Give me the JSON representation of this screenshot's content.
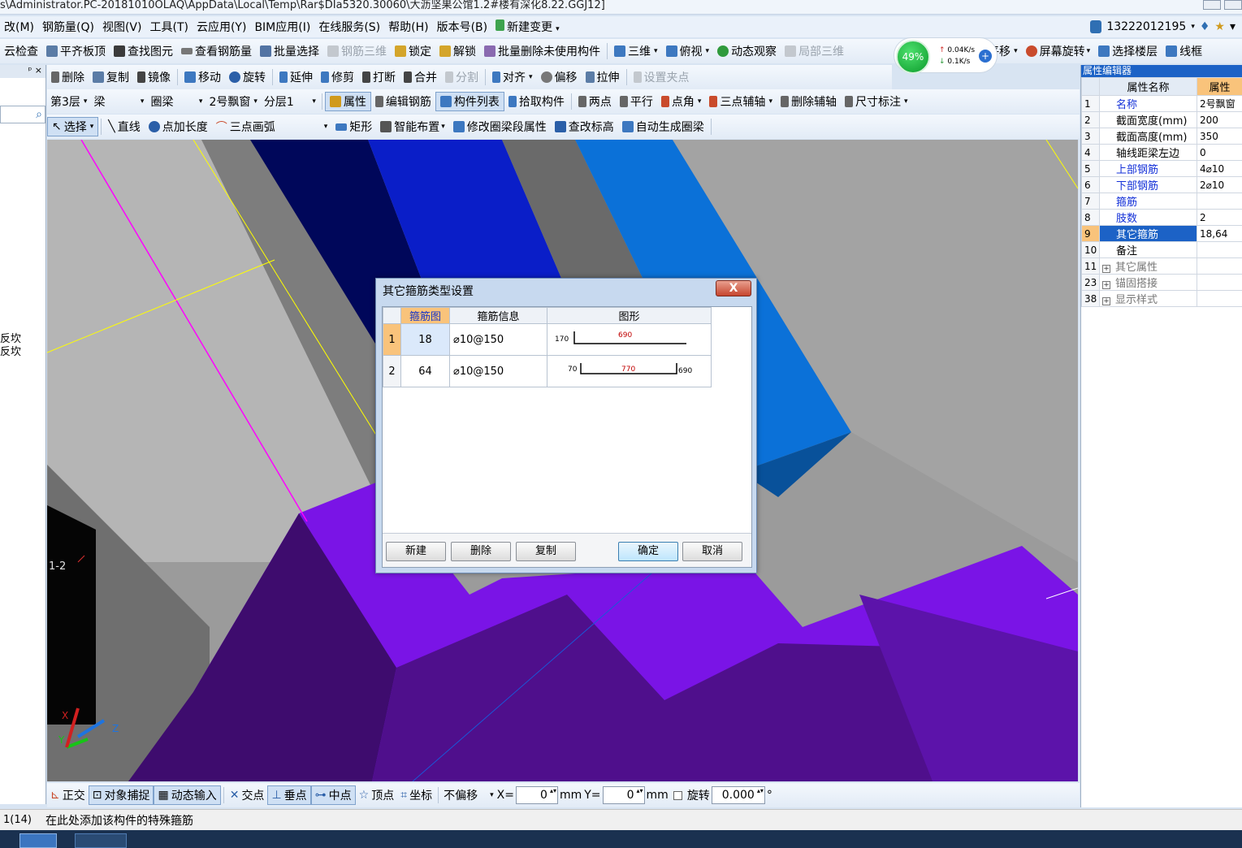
{
  "titlebar": {
    "text": "s\\Administrator.PC-20181010OLAQ\\AppData\\Local\\Temp\\Rar$DIa5320.30060\\大沥坚果公馆1.2#楼有深化8.22.GGJ12]"
  },
  "menubar": {
    "items": [
      "改(M)",
      "钢筋量(Q)",
      "视图(V)",
      "工具(T)",
      "云应用(Y)",
      "BIM应用(I)",
      "在线服务(S)",
      "帮助(H)",
      "版本号(B)",
      "新建变更"
    ],
    "phone": "13222012195"
  },
  "toolbar1": {
    "items": [
      "云检查",
      "平齐板顶",
      "查找图元",
      "查看钢筋量",
      "批量选择",
      "钢筋三维",
      "锁定",
      "解锁",
      "批量删除未使用构件",
      "三维",
      "俯视",
      "动态观察",
      "局部三维",
      "平移",
      "屏幕旋转",
      "选择楼层",
      "线框"
    ]
  },
  "speed": {
    "percent": "49%",
    "up": "0.04K/s",
    "down": "0.1K/s",
    "plus": "+"
  },
  "toolbar2": {
    "items": [
      "删除",
      "复制",
      "镜像",
      "移动",
      "旋转",
      "延伸",
      "修剪",
      "打断",
      "合并",
      "分割",
      "对齐",
      "偏移",
      "拉伸",
      "设置夹点"
    ]
  },
  "toolbar3": {
    "floor": "第3层",
    "type": "梁",
    "subtype": "圈梁",
    "component": "2号飘窗",
    "layer": "分层1",
    "items": [
      "属性",
      "编辑钢筋",
      "构件列表",
      "拾取构件",
      "两点",
      "平行",
      "点角",
      "三点辅轴",
      "删除辅轴",
      "尺寸标注"
    ]
  },
  "toolbar4": {
    "items": [
      "选择",
      "直线",
      "点加长度",
      "三点画弧",
      "矩形",
      "智能布置",
      "修改圈梁段属性",
      "查改标高",
      "自动生成圈梁"
    ]
  },
  "leftpanel": {
    "pin": "ᵖ ×",
    "items": [
      "反坎",
      "反坎"
    ]
  },
  "viewport": {
    "axis_label": "1-2",
    "axes": {
      "x": "X",
      "y": "Y",
      "z": "Z"
    }
  },
  "rightpanel": {
    "title": "属性编辑器",
    "headers": [
      "属性名称",
      "属性"
    ],
    "rows": [
      {
        "n": "1",
        "k": "名称",
        "v": "2号飘窗",
        "style": "blue"
      },
      {
        "n": "2",
        "k": "截面宽度(mm)",
        "v": "200",
        "style": ""
      },
      {
        "n": "3",
        "k": "截面高度(mm)",
        "v": "350",
        "style": ""
      },
      {
        "n": "4",
        "k": "轴线距梁左边",
        "v": "0",
        "style": ""
      },
      {
        "n": "5",
        "k": "上部钢筋",
        "v": "4⌀10",
        "style": "blue"
      },
      {
        "n": "6",
        "k": "下部钢筋",
        "v": "2⌀10",
        "style": "blue"
      },
      {
        "n": "7",
        "k": "箍筋",
        "v": "",
        "style": "blue"
      },
      {
        "n": "8",
        "k": "肢数",
        "v": "2",
        "style": "blue"
      },
      {
        "n": "9",
        "k": "其它箍筋",
        "v": "18,64",
        "style": "sel"
      },
      {
        "n": "10",
        "k": "备注",
        "v": "",
        "style": ""
      },
      {
        "n": "11",
        "k": "其它属性",
        "v": "",
        "style": "grey"
      },
      {
        "n": "23",
        "k": "锚固搭接",
        "v": "",
        "style": "grey"
      },
      {
        "n": "38",
        "k": "显示样式",
        "v": "",
        "style": "grey"
      }
    ]
  },
  "dialog": {
    "title": "其它箍筋类型设置",
    "close": "X",
    "headers": [
      "箍筋图",
      "箍筋信息",
      "图形"
    ],
    "rows": [
      {
        "n": "1",
        "code": "18",
        "info": "⌀10@150",
        "left": "170",
        "mid": "690",
        "right": ""
      },
      {
        "n": "2",
        "code": "64",
        "info": "⌀10@150",
        "left": "70",
        "mid": "770",
        "right": "690"
      }
    ],
    "buttons": {
      "new": "新建",
      "delete": "删除",
      "copy": "复制",
      "ok": "确定",
      "cancel": "取消"
    }
  },
  "statusbar": {
    "items": [
      "正交",
      "对象捕捉",
      "动态输入",
      "交点",
      "垂点",
      "中点",
      "顶点",
      "坐标",
      "不偏移"
    ],
    "x_label": "X=",
    "x_value": "0",
    "y_label": "Y=",
    "y_value": "0",
    "unit": "mm",
    "rotate_label": "旋转",
    "rotate_value": "0.000",
    "degree": "°"
  },
  "hintbar": {
    "left": "1(14)",
    "text": "在此处添加该构件的特殊箍筋"
  },
  "colors": {
    "purple": "#7a14e6",
    "navy": "#00075a",
    "blue": "#0a1ec8",
    "azure": "#0b71d8",
    "grey": "#9b9b9b",
    "selection": "#1c62c6"
  }
}
